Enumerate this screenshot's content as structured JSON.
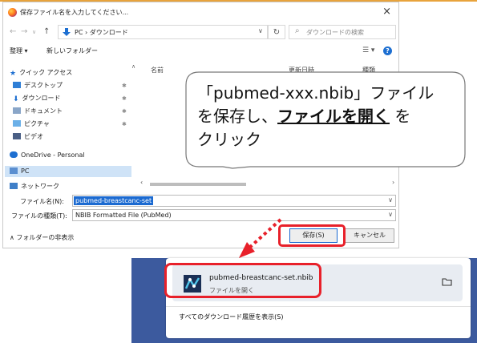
{
  "dialog": {
    "title": "保存ファイル名を入力してください...",
    "path": "PC › ダウンロード",
    "search_placeholder": "ダウンロードの検索",
    "toolbar": {
      "organize": "整理 ▾",
      "new_folder": "新しいフォルダー"
    },
    "columns": {
      "name": "名前",
      "date": "更新日時",
      "type": "種類"
    },
    "nav_items": [
      {
        "label": "クイック アクセス",
        "icon": "star-icon"
      },
      {
        "label": "デスクトップ",
        "icon": "desktop-icon"
      },
      {
        "label": "ダウンロード",
        "icon": "download-icon"
      },
      {
        "label": "ドキュメント",
        "icon": "document-icon"
      },
      {
        "label": "ピクチャ",
        "icon": "picture-icon"
      },
      {
        "label": "ビデオ",
        "icon": "video-icon"
      },
      {
        "label": "OneDrive - Personal",
        "icon": "cloud-icon"
      },
      {
        "label": "PC",
        "icon": "pc-icon"
      },
      {
        "label": "ネットワーク",
        "icon": "network-icon"
      }
    ],
    "filename_label": "ファイル名(N):",
    "filename_value": "pubmed-breastcanc-set",
    "filetype_label": "ファイルの種類(T):",
    "filetype_value": "NBIB Formatted File (PubMed)",
    "folders_toggle": "∧ フォルダーの非表示",
    "save_label": "保存(S)",
    "cancel_label": "キャンセル"
  },
  "callout": {
    "line1": "「pubmed-xxx.nbib」ファイル",
    "line2_pre": "を保存し、",
    "line2_link": "ファイルを開く",
    "line2_post": "を",
    "line3": "クリック"
  },
  "downloads": {
    "file_name": "pubmed-breastcanc-set.nbib",
    "open_label": "ファイルを開く",
    "history_label": "すべてのダウンロード履歴を表示(S)"
  },
  "colors": {
    "highlight": "#e8202a",
    "accent": "#1b6ad1",
    "panel_bg": "#3c5a9e"
  }
}
